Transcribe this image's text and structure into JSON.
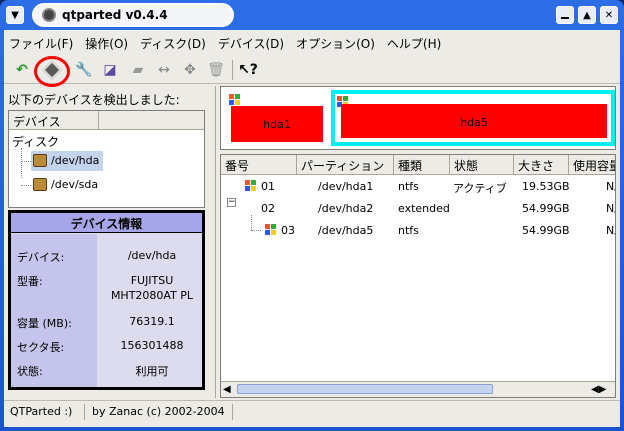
{
  "window": {
    "title": "qtparted v0.4.4"
  },
  "menu": [
    "ファイル(F)",
    "操作(O)",
    "ディスク(D)",
    "デバイス(D)",
    "オプション(O)",
    "ヘルプ(H)"
  ],
  "toolbar": {
    "icons": [
      "undo-arrow-icon",
      "commit-disk-icon",
      "wrench-icon",
      "format-icon",
      "eraser-icon",
      "resize-icon",
      "move-icon",
      "trash-icon",
      "whatsthis-help-icon"
    ]
  },
  "left": {
    "detected_label": "以下のデバイスを検出しました:",
    "tree_header": "デバイス",
    "tree_root": "ディスク",
    "devices": [
      "/dev/hda",
      "/dev/sda"
    ]
  },
  "device_info": {
    "title": "デバイス情報",
    "rows": [
      {
        "label": "デバイス:",
        "value": "/dev/hda"
      },
      {
        "label": "型番:",
        "value": "FUJITSU\nMHT2080AT PL"
      },
      {
        "label": "容量 (MB):",
        "value": "76319.1"
      },
      {
        "label": "セクタ長:",
        "value": "156301488"
      },
      {
        "label": "状態:",
        "value": "利用可"
      }
    ]
  },
  "map": {
    "partitions": [
      "hda1",
      "hda5"
    ],
    "colors": {
      "fill": "#ff0000",
      "selected_border": "#00f0f0"
    }
  },
  "table": {
    "columns": [
      "番号",
      "パーティション",
      "種類",
      "状態",
      "大きさ",
      "使用容量"
    ],
    "rows": [
      {
        "num": "01",
        "partition": "/dev/hda1",
        "type": "ntfs",
        "status": "アクティブ",
        "size": "19.53GB",
        "used": "N/A"
      },
      {
        "num": "02",
        "partition": "/dev/hda2",
        "type": "extended",
        "status": "",
        "size": "54.99GB",
        "used": "N/A"
      },
      {
        "num": "03",
        "partition": "/dev/hda5",
        "type": "ntfs",
        "status": "",
        "size": "54.99GB",
        "used": "N/A"
      }
    ]
  },
  "status": {
    "left": "QTParted :)",
    "right": "by Zanac (c) 2002-2004"
  }
}
